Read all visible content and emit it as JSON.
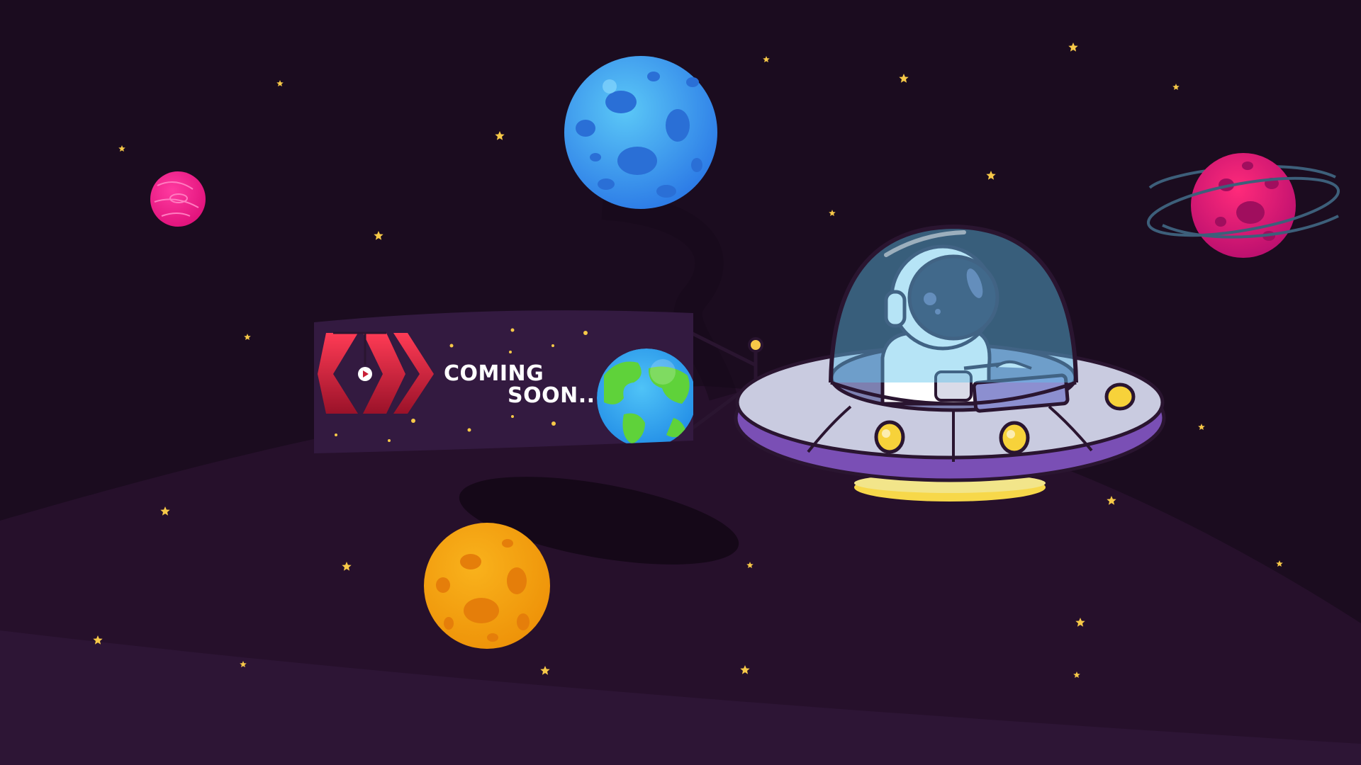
{
  "banner": {
    "line1": "COMING",
    "line2": "SOON..."
  },
  "icons": {
    "logo": "red-chevron-logo-icon",
    "earth": "earth-globe-icon",
    "blue_planet": "blue-cratered-planet-icon",
    "orange_planet": "orange-cratered-planet-icon",
    "pink_planet": "pink-striped-planet-icon",
    "ringed_planet": "ringed-magenta-planet-icon",
    "ufo": "ufo-saucer-icon",
    "astronaut": "astronaut-icon",
    "star": "star-icon"
  },
  "colors": {
    "background": "#1b0c1f",
    "ground": "#2a1230",
    "banner": "#331a40",
    "star": "#f7c948",
    "logo_red": "#e8304a",
    "blue_planet": "#3b9bf0",
    "orange_planet": "#f0a30a",
    "pink_planet": "#ff1f8a",
    "ringed_planet": "#e0116a",
    "ufo_body": "#c9cbe0",
    "ufo_rim": "#7a4fb5",
    "dome": "#5ec4ec"
  }
}
